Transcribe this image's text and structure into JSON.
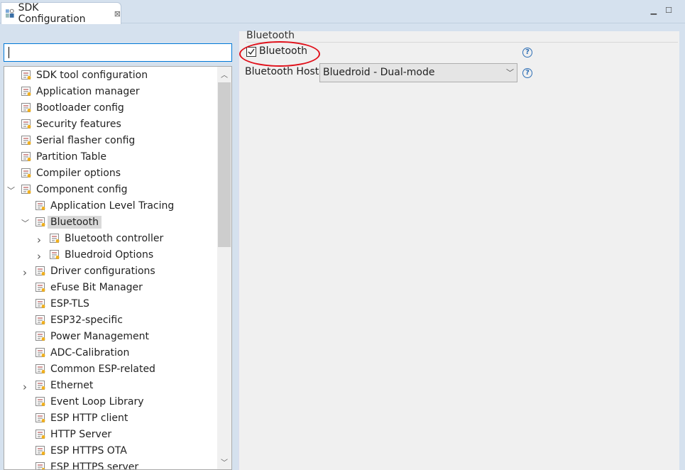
{
  "tab": {
    "title": "SDK Configuration",
    "close_icon": "close-icon"
  },
  "search": {
    "value": "",
    "placeholder": ""
  },
  "tree": [
    {
      "label": "SDK tool configuration",
      "level": 0,
      "toggle": ""
    },
    {
      "label": "Application manager",
      "level": 0,
      "toggle": ""
    },
    {
      "label": "Bootloader config",
      "level": 0,
      "toggle": ""
    },
    {
      "label": "Security features",
      "level": 0,
      "toggle": ""
    },
    {
      "label": "Serial flasher config",
      "level": 0,
      "toggle": ""
    },
    {
      "label": "Partition Table",
      "level": 0,
      "toggle": ""
    },
    {
      "label": "Compiler options",
      "level": 0,
      "toggle": ""
    },
    {
      "label": "Component config",
      "level": 0,
      "toggle": "expanded"
    },
    {
      "label": "Application Level Tracing",
      "level": 1,
      "toggle": ""
    },
    {
      "label": "Bluetooth",
      "level": 1,
      "toggle": "expanded",
      "selected": true
    },
    {
      "label": "Bluetooth controller",
      "level": 2,
      "toggle": "collapsed"
    },
    {
      "label": "Bluedroid Options",
      "level": 2,
      "toggle": "collapsed"
    },
    {
      "label": "Driver configurations",
      "level": 1,
      "toggle": "collapsed"
    },
    {
      "label": "eFuse Bit Manager",
      "level": 1,
      "toggle": ""
    },
    {
      "label": "ESP-TLS",
      "level": 1,
      "toggle": ""
    },
    {
      "label": "ESP32-specific",
      "level": 1,
      "toggle": ""
    },
    {
      "label": "Power Management",
      "level": 1,
      "toggle": ""
    },
    {
      "label": "ADC-Calibration",
      "level": 1,
      "toggle": ""
    },
    {
      "label": "Common ESP-related",
      "level": 1,
      "toggle": ""
    },
    {
      "label": "Ethernet",
      "level": 1,
      "toggle": "collapsed"
    },
    {
      "label": "Event Loop Library",
      "level": 1,
      "toggle": ""
    },
    {
      "label": "ESP HTTP client",
      "level": 1,
      "toggle": ""
    },
    {
      "label": "HTTP Server",
      "level": 1,
      "toggle": ""
    },
    {
      "label": "ESP HTTPS OTA",
      "level": 1,
      "toggle": ""
    },
    {
      "label": "ESP HTTPS server",
      "level": 1,
      "toggle": ""
    }
  ],
  "panel": {
    "group_title": "Bluetooth",
    "checkbox_label": "Bluetooth",
    "checkbox_checked": true,
    "host_label": "Bluetooth Host",
    "host_value": "Bluedroid - Dual-mode"
  },
  "colors": {
    "highlight": "#e0101a",
    "help": "#2e6fb5",
    "focus": "#0078d7"
  }
}
